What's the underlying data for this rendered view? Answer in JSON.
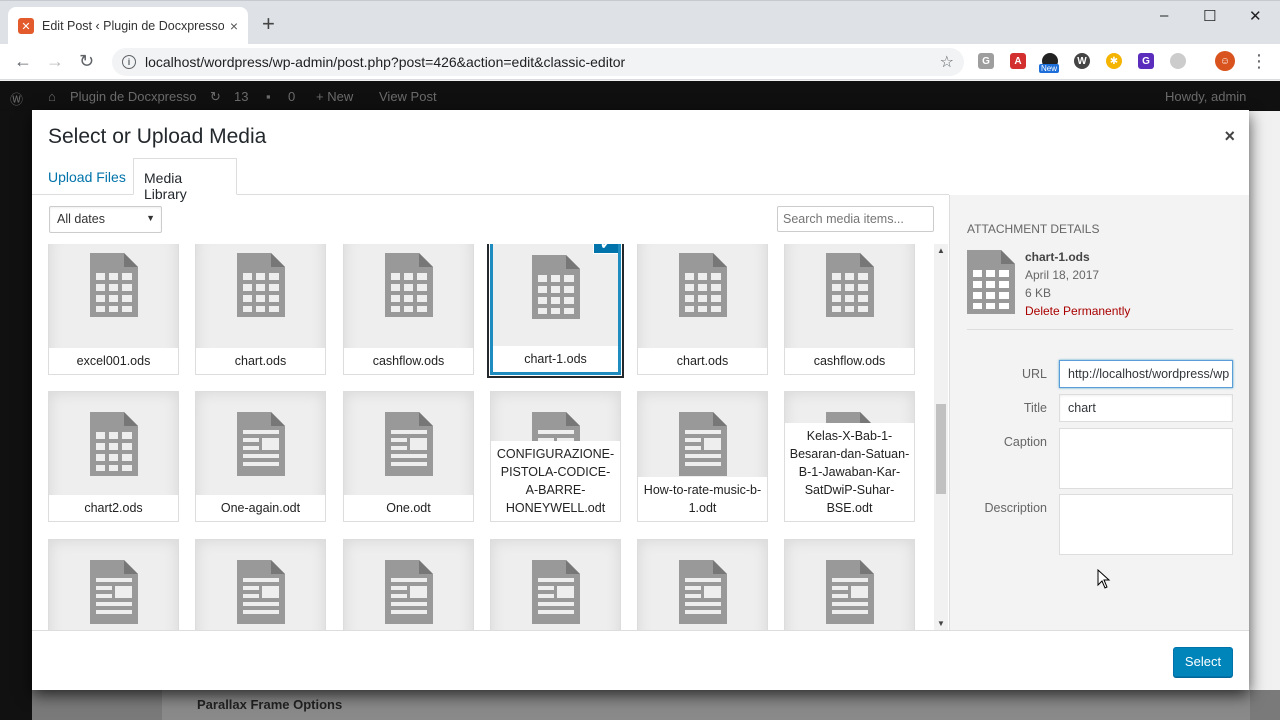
{
  "browser": {
    "tab_title": "Edit Post ‹ Plugin de Docxpresso",
    "tab_close": "×",
    "new_tab": "+",
    "url": "localhost/wordpress/wp-admin/post.php?post=426&action=edit&classic-editor",
    "win_minimize": "–",
    "win_maximize": "☐",
    "win_close": "✕",
    "ext_badge": "New"
  },
  "adminbar": {
    "site_name": "Plugin de Docxpresso",
    "updates": "13",
    "comments": "0",
    "new": "+ New",
    "view_post": "View Post",
    "howdy": "Howdy, admin"
  },
  "page_under": {
    "parallax_label": "Parallax Frame Options"
  },
  "modal": {
    "title": "Select or Upload Media",
    "close": "×",
    "tabs": {
      "upload": "Upload Files",
      "library": "Media Library"
    },
    "filter": {
      "selected": "All dates"
    },
    "search_placeholder": "Search media items...",
    "grid": [
      {
        "name": "excel001.ods",
        "type": "spreadsheet"
      },
      {
        "name": "chart.ods",
        "type": "spreadsheet"
      },
      {
        "name": "cashflow.ods",
        "type": "spreadsheet"
      },
      {
        "name": "chart-1.ods",
        "type": "spreadsheet",
        "selected": true
      },
      {
        "name": "chart.ods",
        "type": "spreadsheet"
      },
      {
        "name": "cashflow.ods",
        "type": "spreadsheet"
      },
      {
        "name": "chart2.ods",
        "type": "spreadsheet"
      },
      {
        "name": "One-again.odt",
        "type": "document"
      },
      {
        "name": "One.odt",
        "type": "document"
      },
      {
        "name": "CONFIGURAZIONE-PISTOLA-CODICE-A-BARRE-HONEYWELL.odt",
        "type": "document"
      },
      {
        "name": "How-to-rate-music-b-1.odt",
        "type": "document"
      },
      {
        "name": "Kelas-X-Bab-1-Besaran-dan-Satuan-B-1-Jawaban-Kar-SatDwiP-Suhar-BSE.odt",
        "type": "document"
      },
      {
        "name": "",
        "type": "document"
      },
      {
        "name": "",
        "type": "document"
      },
      {
        "name": "",
        "type": "document"
      },
      {
        "name": "",
        "type": "document"
      },
      {
        "name": "",
        "type": "document"
      },
      {
        "name": "",
        "type": "document"
      }
    ],
    "details": {
      "heading": "Attachment Details",
      "filename": "chart-1.ods",
      "date": "April 18, 2017",
      "size": "6 KB",
      "delete": "Delete Permanently",
      "url_label": "URL",
      "url_value": "http://localhost/wordpress/wp",
      "title_label": "Title",
      "title_value": "chart",
      "caption_label": "Caption",
      "description_label": "Description"
    },
    "select_button": "Select"
  },
  "colors": {
    "accent": "#0073aa",
    "button": "#0085ba",
    "delete": "#a00000"
  }
}
